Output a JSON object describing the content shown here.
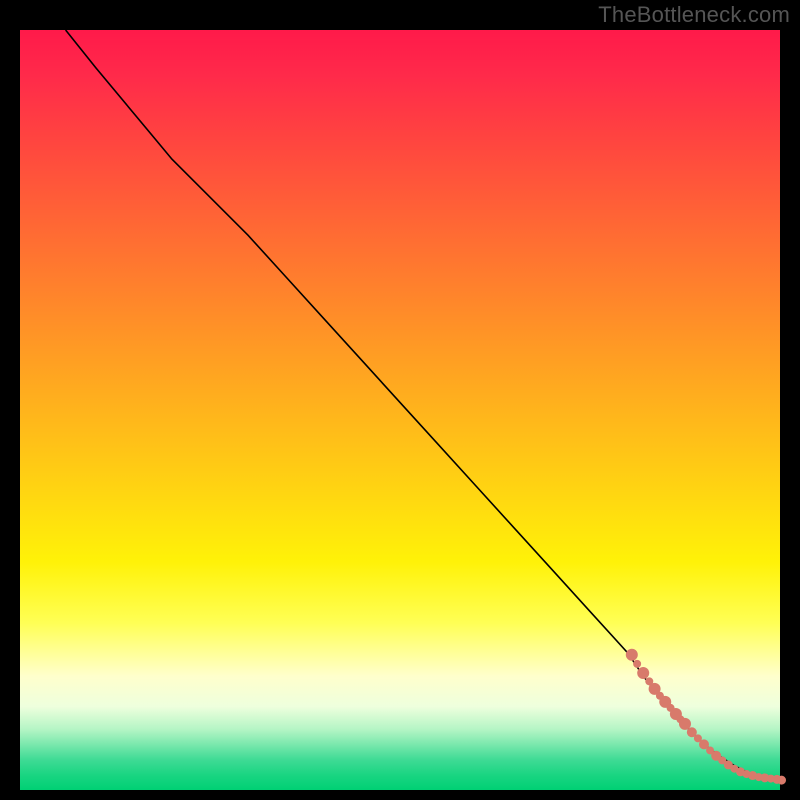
{
  "watermark": "TheBottleneck.com",
  "chart_data": {
    "type": "line",
    "title": "",
    "xlabel": "",
    "ylabel": "",
    "xlim": [
      0,
      100
    ],
    "ylim": [
      0,
      100
    ],
    "background_gradient": {
      "top": "#ff1a4a",
      "middle": "#ffe000",
      "bottom": "#00d074"
    },
    "curve": {
      "x": [
        6,
        10,
        15,
        20,
        25,
        30,
        35,
        40,
        45,
        50,
        55,
        60,
        65,
        70,
        75,
        80,
        82,
        84,
        86,
        88,
        90,
        92,
        94,
        96,
        98,
        100
      ],
      "y": [
        100,
        95,
        89,
        83,
        78,
        73,
        67.5,
        62,
        56.5,
        51,
        45.5,
        40,
        34.5,
        29,
        23.5,
        18,
        15,
        12.5,
        10,
        8,
        6,
        4.5,
        3.2,
        2.2,
        1.6,
        1.2
      ]
    },
    "dots": {
      "x": [
        80.5,
        81.2,
        82.0,
        82.8,
        83.5,
        84.2,
        84.9,
        85.6,
        86.3,
        86.9,
        87.5,
        88.4,
        89.2,
        90.0,
        90.8,
        91.6,
        92.4,
        93.2,
        94.0,
        94.8,
        95.6,
        96.4,
        97.2,
        98.0,
        98.8,
        99.6,
        100.2
      ],
      "y": [
        17.8,
        16.6,
        15.4,
        14.3,
        13.3,
        12.4,
        11.6,
        10.8,
        10.0,
        9.3,
        8.7,
        7.6,
        6.8,
        6.0,
        5.2,
        4.5,
        3.9,
        3.3,
        2.8,
        2.4,
        2.1,
        1.9,
        1.7,
        1.6,
        1.5,
        1.4,
        1.3
      ],
      "r": [
        6,
        4,
        6,
        4,
        6,
        4,
        6,
        4,
        6,
        4,
        6,
        5,
        4,
        5,
        4,
        5,
        4,
        4.5,
        4,
        4.5,
        4,
        4.5,
        4,
        4.5,
        4,
        4.5,
        4.5
      ]
    }
  }
}
